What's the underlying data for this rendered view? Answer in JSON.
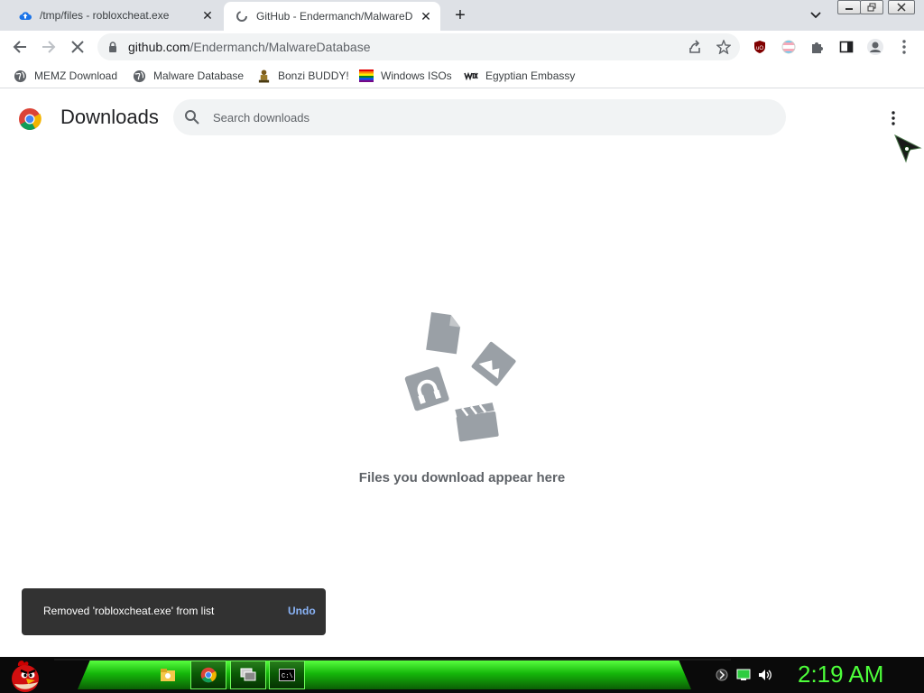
{
  "tabs": [
    {
      "title": "/tmp/files - robloxcheat.exe",
      "active": false,
      "favicon": "cloud-upload-icon"
    },
    {
      "title": "GitHub - Endermanch/MalwareD",
      "active": true,
      "favicon": "loading-spinner-icon"
    }
  ],
  "window_controls": {
    "minimize": "minimize-icon",
    "restore": "restore-icon",
    "close": "close-icon"
  },
  "omnibox": {
    "domain": "github.com",
    "path": "/Endermanch/MalwareDatabase"
  },
  "bookmarks": [
    {
      "label": "MEMZ Download",
      "icon": "globe-icon"
    },
    {
      "label": "Malware Database",
      "icon": "globe-icon"
    },
    {
      "label": "Bonzi BUDDY!",
      "icon": "bonzi-icon"
    },
    {
      "label": "Windows ISOs",
      "icon": "rainbow-flag-icon"
    },
    {
      "label": "Egyptian Embassy",
      "icon": "wix-icon"
    }
  ],
  "downloads": {
    "title": "Downloads",
    "search_placeholder": "Search downloads",
    "empty_message": "Files you download appear here"
  },
  "toast": {
    "message": "Removed 'robloxcheat.exe' from list",
    "action": "Undo"
  },
  "taskbar": {
    "apps": [
      "file-explorer-icon",
      "chrome-icon",
      "remote-desktop-icon",
      "command-prompt-icon"
    ],
    "clock": "2:19 AM",
    "colors": {
      "accent": "#4dff3a",
      "glow": "#15b70a"
    }
  }
}
